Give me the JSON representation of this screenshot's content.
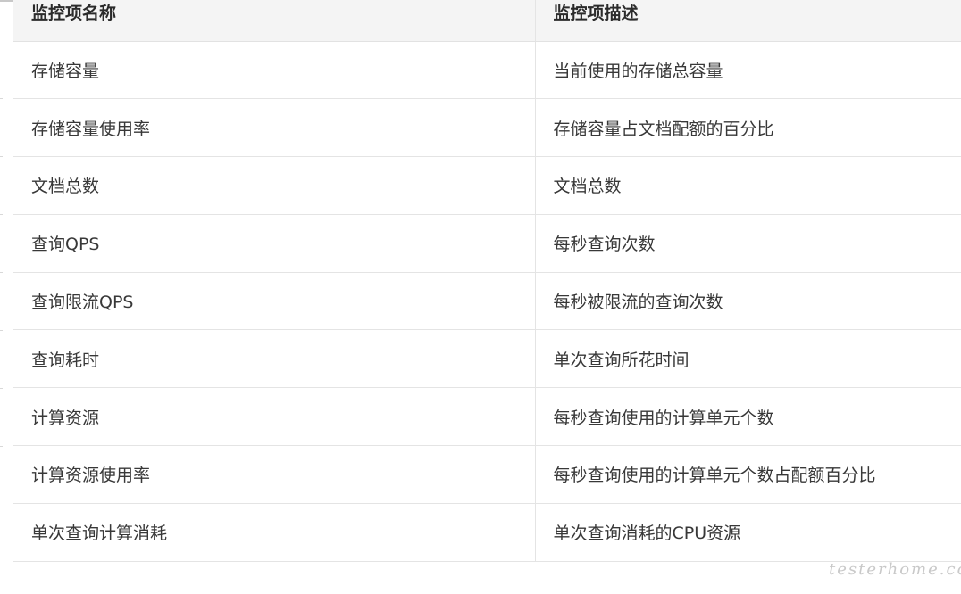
{
  "table": {
    "headers": [
      "监控项名称",
      "监控项描述"
    ],
    "rows": [
      [
        "存储容量",
        "当前使用的存储总容量"
      ],
      [
        "存储容量使用率",
        "存储容量占文档配额的百分比"
      ],
      [
        "文档总数",
        "文档总数"
      ],
      [
        "查询QPS",
        "每秒查询次数"
      ],
      [
        "查询限流QPS",
        "每秒被限流的查询次数"
      ],
      [
        "查询耗时",
        "单次查询所花时间"
      ],
      [
        "计算资源",
        "每秒查询使用的计算单元个数"
      ],
      [
        "计算资源使用率",
        "每秒查询使用的计算单元个数占配额百分比"
      ],
      [
        "单次查询计算消耗",
        "单次查询消耗的CPU资源"
      ]
    ]
  },
  "watermark": "testerhome.com"
}
